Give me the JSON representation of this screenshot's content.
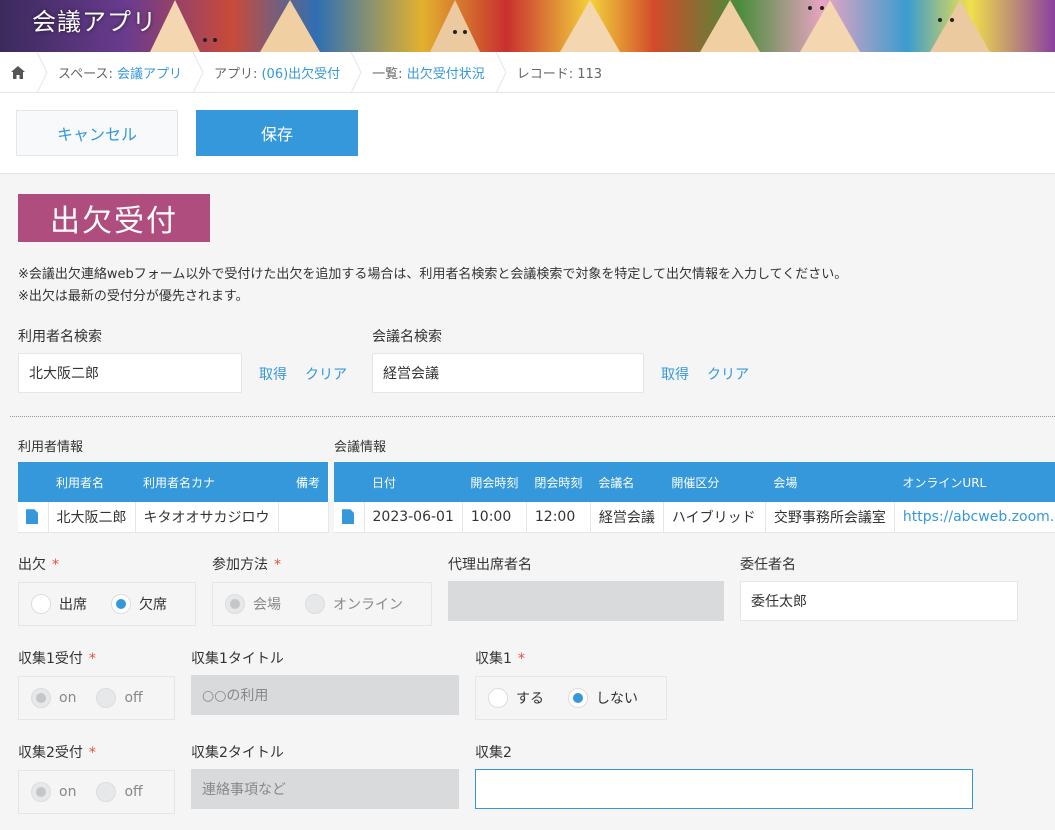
{
  "header": {
    "app_title": "会議アプリ"
  },
  "breadcrumb": {
    "space_prefix": "スペース: ",
    "space_link": "会議アプリ",
    "app_prefix": "アプリ: ",
    "app_link": "(06)出欠受付",
    "list_prefix": "一覧: ",
    "list_link": "出欠受付状況",
    "record": "レコード: 113"
  },
  "toolbar": {
    "cancel_label": "キャンセル",
    "save_label": "保存"
  },
  "form": {
    "section_label": "出欠受付",
    "note1": "※会議出欠連絡webフォーム以外で受付けた出欠を追加する場合は、利用者名検索と会議検索で対象を特定して出欠情報を入力してください。",
    "note2": "※出欠は最新の受付分が優先されます。",
    "user_search": {
      "label": "利用者名検索",
      "value": "北大阪二郎",
      "get": "取得",
      "clear": "クリア"
    },
    "meeting_search": {
      "label": "会議名検索",
      "value": "経営会議",
      "get": "取得",
      "clear": "クリア"
    },
    "user_info": {
      "label": "利用者情報",
      "columns": [
        "利用者名",
        "利用者名カナ",
        "備考"
      ],
      "rows": [
        [
          "北大阪二郎",
          "キタオオサカジロウ",
          ""
        ]
      ]
    },
    "meeting_info": {
      "label": "会議情報",
      "columns": [
        "日付",
        "開会時刻",
        "閉会時刻",
        "会議名",
        "開催区分",
        "会場",
        "オンラインURL"
      ],
      "rows": [
        [
          "2023-06-01",
          "10:00",
          "12:00",
          "経営会議",
          "ハイブリッド",
          "交野事務所会議室",
          "https://abcweb.zoom."
        ]
      ]
    },
    "attendance": {
      "label": "出欠",
      "options": [
        "出席",
        "欠席"
      ],
      "selected": "欠席"
    },
    "method": {
      "label": "参加方法",
      "options": [
        "会場",
        "オンライン"
      ],
      "selected": "会場"
    },
    "proxy": {
      "label": "代理出席者名",
      "value": ""
    },
    "delegate": {
      "label": "委任者名",
      "value": "委任太郎"
    },
    "collect1_accept": {
      "label": "収集1受付",
      "options": [
        "on",
        "off"
      ],
      "selected": "on"
    },
    "collect1_title": {
      "label": "収集1タイトル",
      "value": "○○の利用"
    },
    "collect1": {
      "label": "収集1",
      "options": [
        "する",
        "しない"
      ],
      "selected": "しない"
    },
    "collect2_accept": {
      "label": "収集2受付",
      "options": [
        "on",
        "off"
      ],
      "selected": "on"
    },
    "collect2_title": {
      "label": "収集2タイトル",
      "value": "連絡事項など"
    },
    "collect2": {
      "label": "収集2",
      "value": ""
    },
    "required_mark": "*"
  }
}
